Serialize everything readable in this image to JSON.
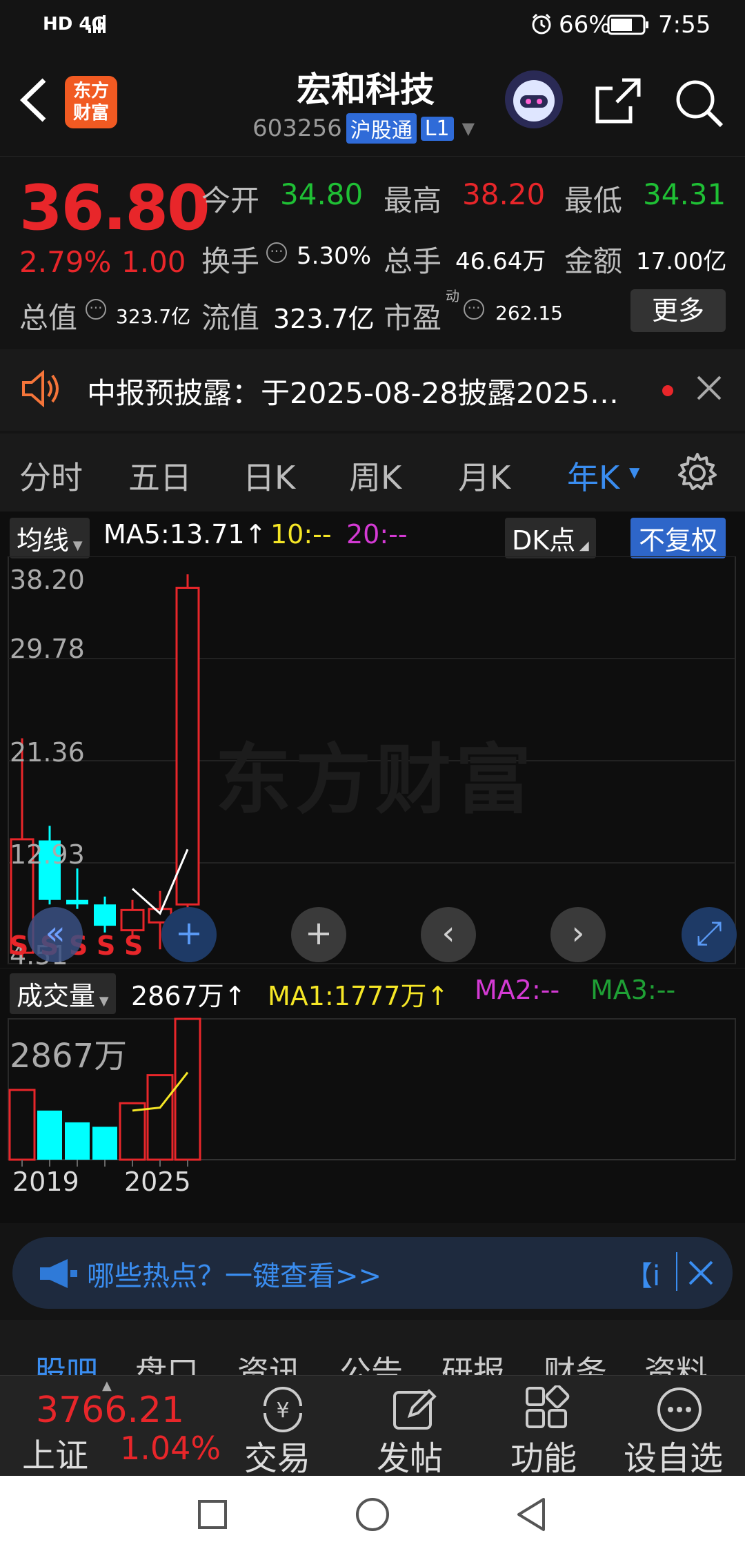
{
  "status_bar": {
    "signal": "HD 4G",
    "battery": "66%",
    "time": "7:55"
  },
  "header": {
    "logo_text": "东方财富",
    "title": "宏和科技",
    "code": "603256",
    "market_tag": "沪股通",
    "level_tag": "L1"
  },
  "quote": {
    "price": "36.80",
    "change_pct": "2.79%",
    "change_abs": "1.00",
    "open_label": "今开",
    "open": "34.80",
    "high_label": "最高",
    "high": "38.20",
    "low_label": "最低",
    "low": "34.31",
    "turnover_label": "换手",
    "turnover": "5.30%",
    "volume_label": "总手",
    "volume": "46.64万",
    "amount_label": "金额",
    "amount": "17.00亿",
    "mktcap_label": "总值",
    "mktcap": "323.7亿",
    "float_label": "流值",
    "float_cap": "323.7亿",
    "pe_label": "市盈",
    "pe_sup": "动",
    "pe": "262.15",
    "more_label": "更多"
  },
  "notice": {
    "text": "中报预披露：于2025-08-28披露2025…"
  },
  "period_tabs": [
    "分时",
    "五日",
    "日K",
    "周K",
    "月K",
    "年K"
  ],
  "kline_toolbar": {
    "ma_select": "均线",
    "ma5": "MA5:13.71↑",
    "ma10": "10:--",
    "ma20": "20:--",
    "dk_label": "DK点",
    "adjust_label": "不复权"
  },
  "volume_toolbar": {
    "select": "成交量",
    "value": "2867万↑",
    "ma1": "MA1:1777万↑",
    "ma2": "MA2:--",
    "ma3": "MA3:--"
  },
  "watermark": "东方财富",
  "signal_marks": [
    "S",
    "S",
    "S",
    "S",
    "S"
  ],
  "colors": {
    "up": "#e8262a",
    "down": "#00ffff",
    "accent": "#3a8df0",
    "ma5": "#ffffff",
    "ma10": "#f5e626",
    "ma20": "#d43ad4",
    "ma3": "#1fa035"
  },
  "chart_data": {
    "type": "candlestick",
    "x_labels": [
      "2019",
      "2025"
    ],
    "y_ticks": [
      "38.20",
      "29.78",
      "21.36",
      "12.93",
      "4.51"
    ],
    "ylim": [
      4.51,
      38.2
    ],
    "candles": [
      {
        "open": 4.5,
        "close": 14.6,
        "high": 23.6,
        "low": 4.0,
        "dir": "up"
      },
      {
        "open": 14.5,
        "close": 9.2,
        "high": 15.8,
        "low": 8.8,
        "dir": "down"
      },
      {
        "open": 9.2,
        "close": 8.8,
        "high": 12.0,
        "low": 8.4,
        "dir": "down"
      },
      {
        "open": 8.8,
        "close": 6.9,
        "high": 9.5,
        "low": 6.3,
        "dir": "down"
      },
      {
        "open": 6.5,
        "close": 8.3,
        "high": 9.2,
        "low": 6.0,
        "dir": "up"
      },
      {
        "open": 7.2,
        "close": 8.4,
        "high": 10.0,
        "low": 4.8,
        "dir": "up"
      },
      {
        "open": 8.8,
        "close": 37.0,
        "high": 38.2,
        "low": 7.9,
        "dir": "up"
      }
    ],
    "ma5": [
      null,
      null,
      null,
      null,
      10.2,
      8.0,
      13.71
    ],
    "volume_label": "2867万",
    "volumes": [
      1420,
      1000,
      760,
      670,
      1150,
      1720,
      2867
    ],
    "volume_ma1": [
      null,
      null,
      null,
      null,
      1000,
      1060,
      1777
    ]
  },
  "chart_controls": {
    "collapse": "«",
    "plus_a": "+",
    "plus_b": "+",
    "prev": "‹",
    "next": "›",
    "expand": "⤢"
  },
  "bottom_ad": {
    "text": "哪些热点？一键查看>>",
    "right_tag": "【i"
  },
  "bottom_tabs": [
    "股吧",
    "盘口",
    "资讯",
    "公告",
    "研报",
    "财务",
    "资料"
  ],
  "bottom_nav": {
    "index_value": "3766.21",
    "index_name": "上证",
    "index_change": "1.04%",
    "items": [
      "交易",
      "发帖",
      "功能",
      "设自选"
    ]
  }
}
